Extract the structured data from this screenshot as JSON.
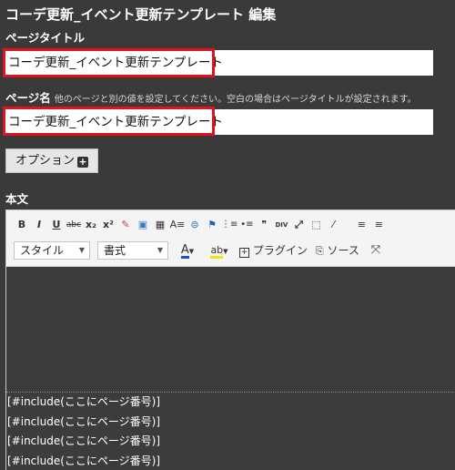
{
  "page": {
    "title": "コーデ更新_イベント更新テンプレート 編集"
  },
  "page_title_field": {
    "label": "ページタイトル",
    "value": "コーデ更新_イベント更新テンプレート"
  },
  "page_name_field": {
    "label": "ページ名",
    "hint": "他のページと別の値を設定してください。空白の場合はページタイトルが設定されます。",
    "value": "コーデ更新_イベント更新テンプレート"
  },
  "option_button": {
    "label": "オプション",
    "icon": "plus-square-icon"
  },
  "body_section": {
    "label": "本文"
  },
  "toolbar": {
    "row1": [
      {
        "name": "bold-button",
        "glyph": "B"
      },
      {
        "name": "italic-button",
        "glyph": "I"
      },
      {
        "name": "underline-button",
        "glyph": "U"
      },
      {
        "name": "strikethrough-button",
        "glyph": "abc"
      },
      {
        "name": "subscript-button",
        "glyph": "x₂"
      },
      {
        "name": "superscript-button",
        "glyph": "x²"
      },
      {
        "name": "remove-format-button",
        "glyph": "✎"
      },
      {
        "name": "image-button",
        "glyph": "▣"
      },
      {
        "name": "table-button",
        "glyph": "▦"
      },
      {
        "name": "text-format-button",
        "glyph": "A≡"
      },
      {
        "name": "link-button",
        "glyph": "⊜"
      },
      {
        "name": "anchor-flag-button",
        "glyph": "⚑"
      },
      {
        "name": "numbered-list-button",
        "glyph": "⋮≡"
      },
      {
        "name": "bulleted-list-button",
        "glyph": "•≡"
      },
      {
        "name": "blockquote-button",
        "glyph": "❞"
      },
      {
        "name": "div-button",
        "glyph": "DIV"
      },
      {
        "name": "maximize-button",
        "glyph": "⤢"
      },
      {
        "name": "show-blocks-button",
        "glyph": "⬚"
      },
      {
        "name": "eyedropper-button",
        "glyph": "⁄"
      },
      {
        "name": "align-left-button",
        "glyph": "≡"
      },
      {
        "name": "align-center-button",
        "glyph": "≡"
      }
    ],
    "style_dropdown": "スタイル",
    "format_dropdown": "書式",
    "text_color_glyph": "A",
    "bg_color_glyph": "ab",
    "plugin_label": "プラグイン",
    "source_label": "ソース"
  },
  "editor_lines": [
    "[#include(ここにページ番号)]",
    "[#include(ここにページ番号)]",
    "[#include(ここにページ番号)]",
    "[#include(ここにページ番号)]"
  ],
  "colors": {
    "background": "#3a3a3a",
    "highlight_border": "#e0141e",
    "text_color_underline": "#1a4fd6",
    "bg_color_underline": "#f2e600"
  }
}
